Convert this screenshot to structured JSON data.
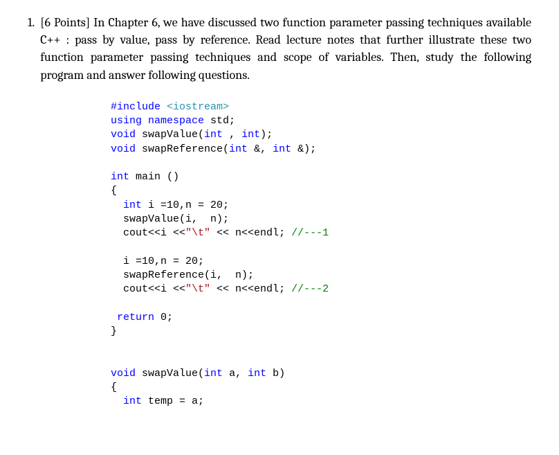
{
  "question": {
    "number": "1.",
    "text": "[6 Points] In Chapter 6, we have discussed two function parameter passing techniques available C++  : pass by value, pass by reference. Read lecture notes that further illustrate these two function parameter passing techniques and scope of variables.  Then, study the following program and answer following questions."
  },
  "code": {
    "l1_include": "#include",
    "l1_header": " <iostream>",
    "l2_using": "using",
    "l2_namespace": " namespace",
    "l2_std": " std;",
    "l3_void": "void",
    "l3_rest": " swapValue(",
    "l3_int1": "int",
    "l3_comma": " , ",
    "l3_int2": "int",
    "l3_end": ");",
    "l4_void": "void",
    "l4_rest": " swapReference(",
    "l4_int1": "int",
    "l4_amp1": " &, ",
    "l4_int2": "int",
    "l4_end": " &);",
    "l6_int": "int",
    "l6_main": " main ()",
    "l7_brace": "{",
    "l8_indent": "  ",
    "l8_int": "int",
    "l8_rest": " i =10,n = 20;",
    "l9_indent": "  swapValue(i,  n);",
    "l10_indent": "  cout<<i <<",
    "l10_str": "\"\\t\"",
    "l10_rest": " << n<<endl; ",
    "l10_comment": "//---1",
    "l12_indent": "  i =10,n = 20;",
    "l13_indent": "  swapReference(i,  n);",
    "l14_indent": "  cout<<i <<",
    "l14_str": "\"\\t\"",
    "l14_rest": " << n<<endl; ",
    "l14_comment": "//---2",
    "l16_return": " return",
    "l16_rest": " 0;",
    "l17_brace": "}",
    "l20_void": "void",
    "l20_rest": " swapValue(",
    "l20_int1": "int",
    "l20_a": " a, ",
    "l20_int2": "int",
    "l20_b": " b)",
    "l21_brace": "{",
    "l22_indent": "  ",
    "l22_int": "int",
    "l22_rest": " temp = a;"
  }
}
